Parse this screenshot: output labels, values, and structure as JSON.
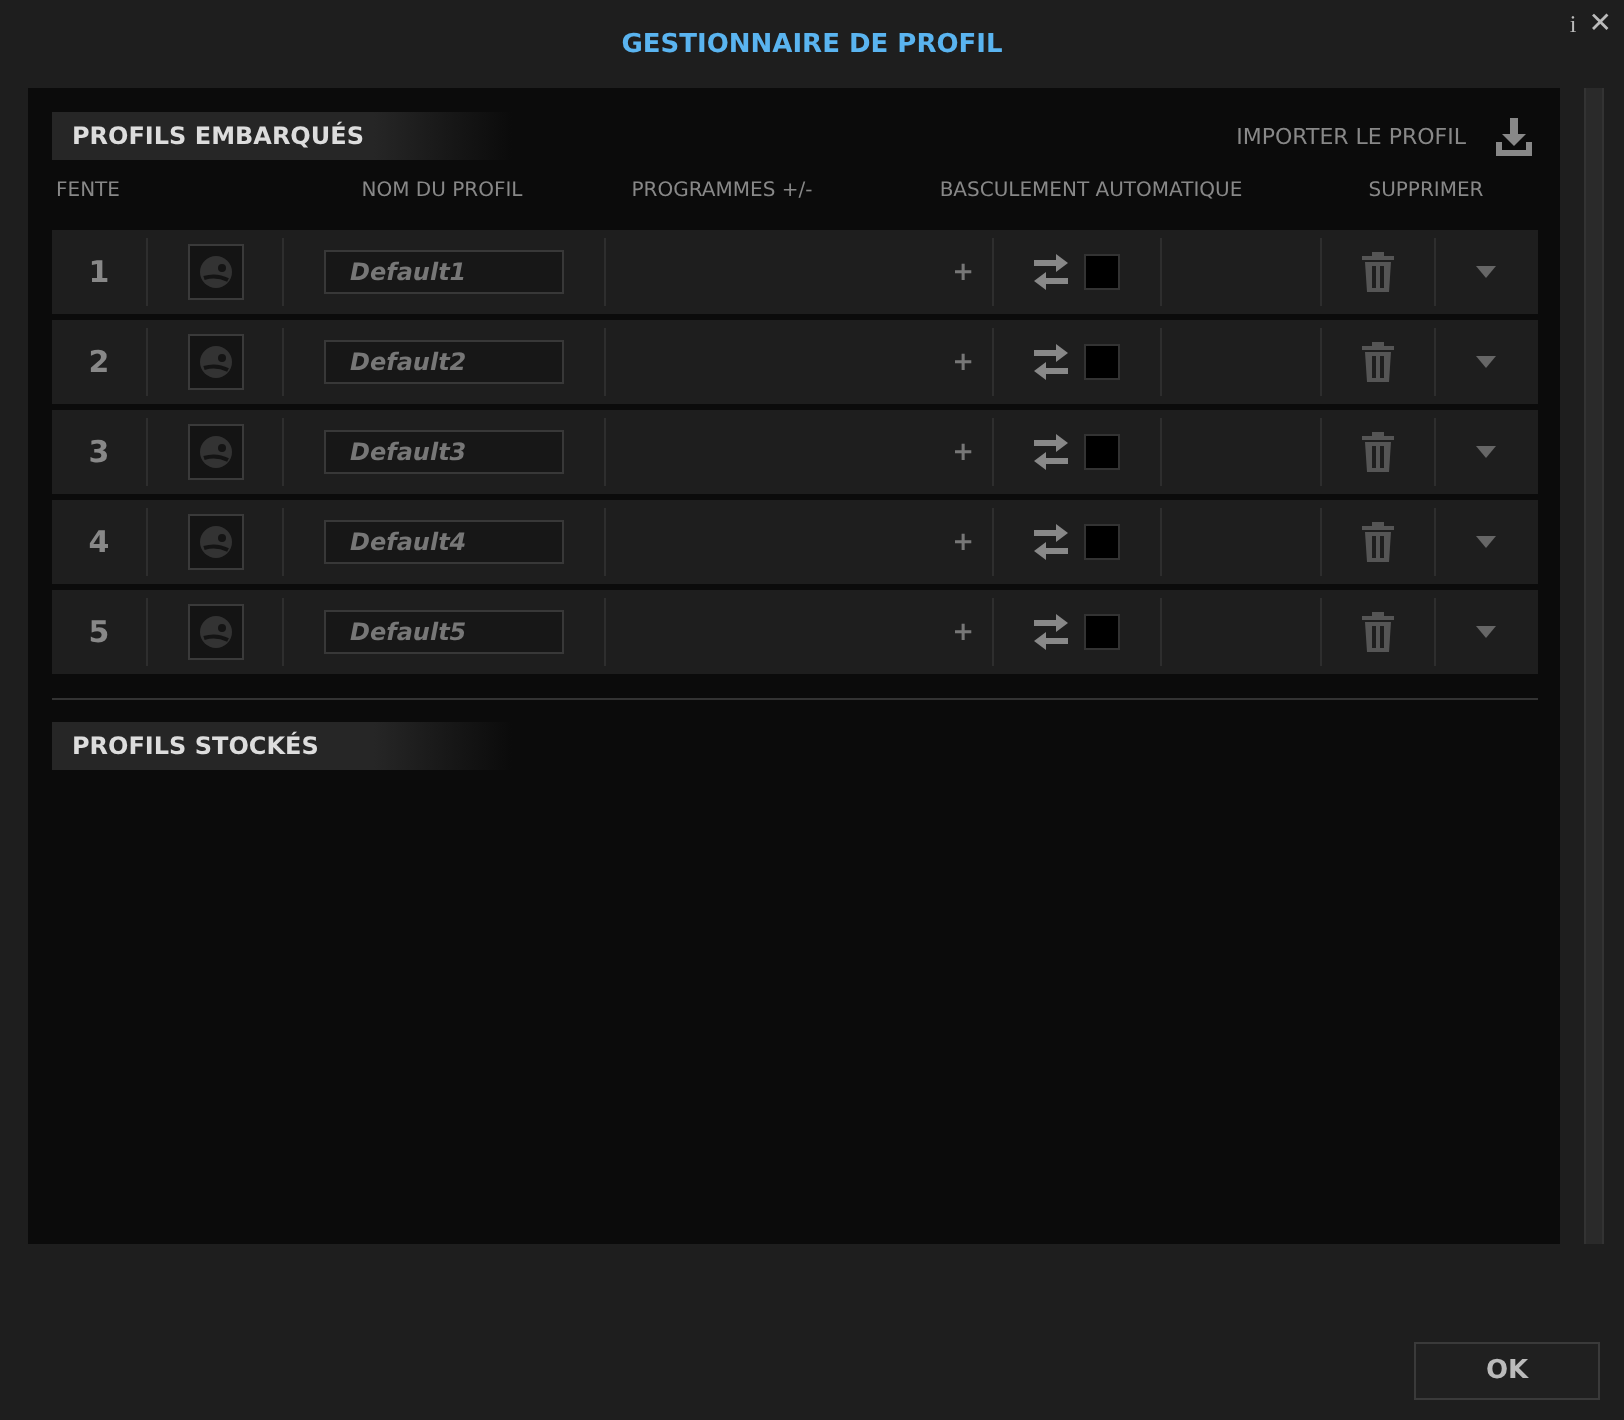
{
  "window": {
    "title": "GESTIONNAIRE DE PROFIL",
    "info": "i",
    "close": "✕"
  },
  "onboard": {
    "title": "PROFILS EMBARQUÉS",
    "import_label": "IMPORTER LE PROFIL",
    "columns": [
      "FENTE",
      "NOM DU PROFIL",
      "PROGRAMMES +/-",
      "BASCULEMENT AUTOMATIQUE",
      "SUPPRIMER"
    ],
    "rows": [
      {
        "slot": "1",
        "name": "Default1",
        "plus": "+",
        "auto_switch": false
      },
      {
        "slot": "2",
        "name": "Default2",
        "plus": "+",
        "auto_switch": false
      },
      {
        "slot": "3",
        "name": "Default3",
        "plus": "+",
        "auto_switch": false
      },
      {
        "slot": "4",
        "name": "Default4",
        "plus": "+",
        "auto_switch": false
      },
      {
        "slot": "5",
        "name": "Default5",
        "plus": "+",
        "auto_switch": false
      }
    ]
  },
  "stored": {
    "title": "PROFILS STOCKÉS"
  },
  "buttons": [
    "OK"
  ]
}
